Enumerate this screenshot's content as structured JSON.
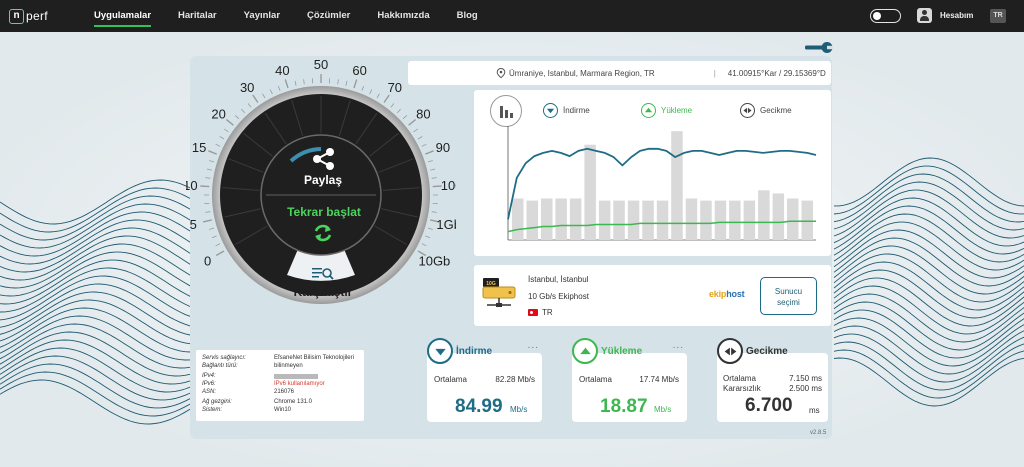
{
  "app": {
    "logo_text": "perf"
  },
  "nav": {
    "items": [
      {
        "label": "Uygulamalar",
        "active": true
      },
      {
        "label": "Haritalar",
        "active": false
      },
      {
        "label": "Yayınlar",
        "active": false
      },
      {
        "label": "Çözümler",
        "active": false
      },
      {
        "label": "Hakkımızda",
        "active": false
      },
      {
        "label": "Blog",
        "active": false
      }
    ],
    "account_label": "Hesabım",
    "language": "TR"
  },
  "location": {
    "place": "Ümraniye, Istanbul, Marmara Region, TR",
    "separator": "|",
    "coordinates": "41.00915°Kar / 29.15369°D"
  },
  "legend": {
    "download": "İndirme",
    "upload": "Yükleme",
    "ping": "Gecikme"
  },
  "colors": {
    "download": "#1f6c86",
    "upload": "#3cb84f",
    "ping": "#333333",
    "gauge_face": "#1f1f1f",
    "accent_green": "#2fc15a"
  },
  "chart_data": {
    "type": "line",
    "note_series": [
      {
        "name": "İndirme",
        "values": [
          20,
          60,
          74,
          81,
          84,
          86,
          84,
          81,
          86,
          88,
          86,
          84,
          80,
          72,
          80,
          86,
          88,
          88,
          86,
          80,
          84,
          86,
          86,
          84,
          82,
          84,
          86,
          86,
          85,
          84,
          85,
          86,
          86,
          85,
          84,
          82
        ]
      },
      {
        "name": "Yükleme",
        "values": [
          8,
          10,
          11,
          12,
          13,
          13,
          14,
          14,
          14,
          14,
          15,
          15,
          15,
          15,
          15,
          16,
          16,
          16,
          16,
          16,
          16,
          16,
          16,
          16,
          17,
          17,
          17,
          17,
          17,
          17,
          17,
          17,
          18,
          18,
          18,
          18
        ]
      },
      {
        "name": "Gecikme",
        "values": [
          40,
          38,
          40,
          40,
          40,
          92,
          38,
          38,
          38,
          38,
          38,
          105,
          40,
          38,
          38,
          38,
          38,
          48,
          45,
          40,
          38
        ]
      }
    ]
  },
  "gauge": {
    "ticks": [
      "0",
      "5",
      "10",
      "15",
      "20",
      "30",
      "40",
      "50",
      "60",
      "70",
      "80",
      "90",
      "100",
      "1Gb",
      "10Gb"
    ],
    "share_label": "Paylaş",
    "restart_label": "Tekrar başlat",
    "compare_label": "Karşılaştır"
  },
  "server": {
    "city": "İstanbul, İstanbul",
    "host": "10 Gb/s Ekiphost",
    "country": "TR",
    "sponsor_prefix": "ekip",
    "sponsor_suffix": "host",
    "select_label_1": "Sunucu",
    "select_label_2": "seçimi"
  },
  "connection": {
    "rows": [
      {
        "key": "Servis sağlayıcı:",
        "value": "EfsaneNet Bilisim Teknolojileri",
        "value2": "bilinmeyen",
        "redacted": false,
        "warn": false
      },
      {
        "key": "Bağlantı türü:",
        "value": "",
        "redacted": false,
        "warn": false
      },
      {
        "key": "IPv4:",
        "value": "",
        "redacted": true,
        "warn": false
      },
      {
        "key": "IPv6:",
        "value": "IPv6 kullanılamıyor",
        "redacted": false,
        "warn": true
      },
      {
        "key": "ASN:",
        "value": "216076",
        "redacted": false,
        "warn": false
      },
      {
        "key": "Ağ gezgini:",
        "value": "Chrome 131.0",
        "redacted": false,
        "warn": false
      },
      {
        "key": "Sistem:",
        "value": "Win10",
        "redacted": false,
        "warn": false
      }
    ]
  },
  "results": {
    "download": {
      "title": "İndirme",
      "avg_label": "Ortalama",
      "avg_value": "82.28 Mb/s",
      "value": "84.99",
      "unit": "Mb/s",
      "more": "..."
    },
    "upload": {
      "title": "Yükleme",
      "avg_label": "Ortalama",
      "avg_value": "17.74 Mb/s",
      "value": "18.87",
      "unit": "Mb/s",
      "more": "..."
    },
    "ping": {
      "title": "Gecikme",
      "avg_label": "Ortalama",
      "avg_value": "7.150 ms",
      "jitter_label": "Kararsızlık",
      "jitter_value": "2.500 ms",
      "value": "6.700",
      "unit": "ms"
    }
  },
  "version": "v2.8.5"
}
